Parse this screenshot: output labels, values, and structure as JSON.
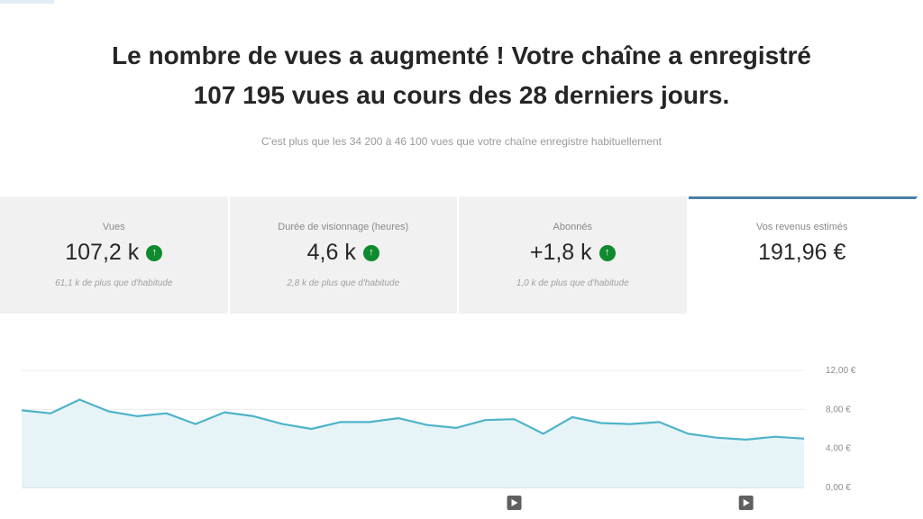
{
  "headline": {
    "line1": "Le nombre de vues a augmenté ! Votre chaîne a enregistré",
    "line2": "107 195 vues au cours des 28 derniers jours."
  },
  "subline": "C'est plus que les 34 200 à 46 100 vues que votre chaîne enregistre habituellement",
  "cards": [
    {
      "label": "Vues",
      "value": "107,2 k",
      "sub": "61,1 k de plus que d'habitude",
      "trend": "up",
      "active": false
    },
    {
      "label": "Durée de visionnage (heures)",
      "value": "4,6 k",
      "sub": "2,8 k de plus que d'habitude",
      "trend": "up",
      "active": false
    },
    {
      "label": "Abonnés",
      "value": "+1,8 k",
      "sub": "1,0 k de plus que d'habitude",
      "trend": "up",
      "active": false
    },
    {
      "label": "Vos revenus estimés",
      "value": "191,96 €",
      "sub": "",
      "trend": "",
      "active": true
    }
  ],
  "colors": {
    "accent": "#4a7fa7",
    "line": "#4fb3c9",
    "fill": "#e6f4f8",
    "up_badge": "#0f8a2e",
    "card_bg": "#f1f1f1"
  },
  "icons": {
    "trend_up": "arrow-up-circle-icon",
    "marker": "play-marker-icon"
  },
  "chart_data": {
    "type": "area",
    "y_tick_labels": [
      "12,00 €",
      "8,00 €",
      "4,00 €",
      "0,00 €"
    ],
    "ylim": [
      0,
      12
    ],
    "values": [
      7.9,
      7.6,
      9.0,
      7.8,
      7.3,
      7.6,
      6.5,
      7.7,
      7.3,
      6.5,
      6.0,
      6.7,
      6.7,
      7.1,
      6.4,
      6.1,
      6.9,
      7.0,
      5.5,
      7.2,
      6.6,
      6.5,
      6.7,
      5.5,
      5.1,
      4.9,
      5.2,
      5.0
    ],
    "markers_at_index": [
      17,
      25
    ],
    "grid": true
  }
}
